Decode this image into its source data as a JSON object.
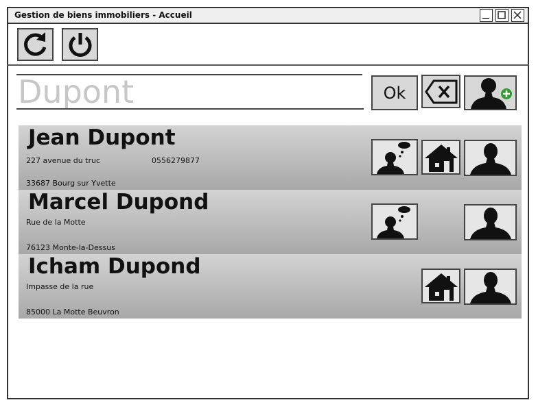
{
  "window": {
    "title": "Gestion de biens immobiliers - Accueil",
    "controls": [
      "minimize-icon",
      "maximize-icon",
      "close-icon"
    ]
  },
  "toolbar": {
    "refresh_icon": "refresh-icon",
    "power_icon": "power-icon"
  },
  "search": {
    "value": "Dupont",
    "ok_label": "Ok",
    "clear_icon": "clear-icon",
    "add_user_icon": "add-user-icon"
  },
  "results": [
    {
      "name": "Jean Dupont",
      "address_line1": "227 avenue du truc",
      "phone": "0556279877",
      "address_line2": "33687 Bourg sur Yvette",
      "actions": [
        "thinking-person-icon",
        "house-icon",
        "person-icon"
      ]
    },
    {
      "name": "Marcel Dupond",
      "address_line1": "Rue de la Motte",
      "phone": "",
      "address_line2": "76123 Monte-la-Dessus",
      "actions": [
        "thinking-person-icon",
        "person-icon"
      ]
    },
    {
      "name": "Icham Dupond",
      "address_line1": "Impasse de la rue",
      "phone": "",
      "address_line2": "85000 La Motte Beuvron",
      "actions": [
        "house-icon",
        "person-icon"
      ]
    }
  ],
  "colors": {
    "row_gradient_top": "#d3d3d3",
    "row_gradient_bottom": "#a8a8a8",
    "add_badge": "#2e9e2e"
  }
}
